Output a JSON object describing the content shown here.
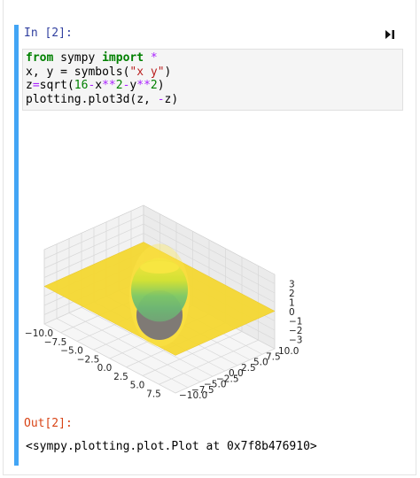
{
  "cell": {
    "input_prompt": "In [2]:",
    "output_prompt": "Out[2]:",
    "output_text": "<sympy.plotting.plot.Plot at 0x7f8b476910>",
    "run_icon": "run-cell-icon",
    "accent_color": "#42a5f5",
    "code_lines": [
      [
        {
          "t": "from",
          "c": "kw"
        },
        {
          "t": " sympy ",
          "c": ""
        },
        {
          "t": "import",
          "c": "kw"
        },
        {
          "t": " ",
          "c": ""
        },
        {
          "t": "*",
          "c": "op"
        }
      ],
      [
        {
          "t": "x, y = symbols(",
          "c": ""
        },
        {
          "t": "\"x y\"",
          "c": "str"
        },
        {
          "t": ")",
          "c": ""
        }
      ],
      [
        {
          "t": "z",
          "c": ""
        },
        {
          "t": "=",
          "c": "op"
        },
        {
          "t": "sqrt(",
          "c": ""
        },
        {
          "t": "16",
          "c": "num"
        },
        {
          "t": "-",
          "c": "op"
        },
        {
          "t": "x",
          "c": ""
        },
        {
          "t": "**",
          "c": "op"
        },
        {
          "t": "2",
          "c": "num"
        },
        {
          "t": "-",
          "c": "op"
        },
        {
          "t": "y",
          "c": ""
        },
        {
          "t": "**",
          "c": "op"
        },
        {
          "t": "2",
          "c": "num"
        },
        {
          "t": ")",
          "c": ""
        }
      ],
      [
        {
          "t": "plotting.plot3d(z, ",
          "c": ""
        },
        {
          "t": "-",
          "c": "op"
        },
        {
          "t": "z)",
          "c": ""
        }
      ]
    ]
  },
  "chart_data": {
    "type": "surface3d",
    "title": "",
    "series": [
      {
        "expression": "sqrt(16-x**2-y**2)"
      },
      {
        "expression": "-sqrt(16-x**2-y**2)"
      }
    ],
    "x_ticks": [
      "−10.0",
      "−7.5",
      "−5.0",
      "−2.5",
      "0.0",
      "2.5",
      "5.0",
      "7.5",
      "10.0"
    ],
    "y_ticks": [
      "−10.0",
      "−7.5",
      "−5.0",
      "−2.5",
      "0.0",
      "2.5",
      "5.0",
      "7.5",
      "10.0"
    ],
    "z_ticks": [
      "3",
      "2",
      "1",
      "0",
      "−1",
      "−2",
      "−3"
    ],
    "xlim": [
      -10,
      10
    ],
    "ylim": [
      -10,
      10
    ],
    "zlim": [
      -4,
      4
    ],
    "colormap": "viridis",
    "surface_color": "#f5d832"
  }
}
